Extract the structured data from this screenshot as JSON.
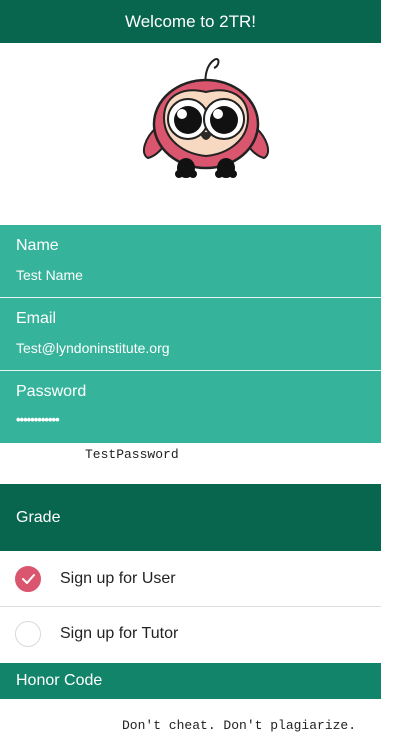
{
  "header": {
    "title": "Welcome to 2TR!"
  },
  "logo": {
    "icon": "owl-mascot-icon"
  },
  "form": {
    "name": {
      "label": "Name",
      "value": "Test Name"
    },
    "email": {
      "label": "Email",
      "value": "Test@lyndoninstitute.org"
    },
    "password": {
      "label": "Password",
      "masked_value": "••••••••••••",
      "debug_text": "TestPassword"
    }
  },
  "grade": {
    "label": "Grade"
  },
  "signup_options": [
    {
      "label": "Sign up for User",
      "checked": true
    },
    {
      "label": "Sign up for Tutor",
      "checked": false
    }
  ],
  "honor_code": {
    "label": "Honor Code",
    "text": "Don't cheat. Don't plagiarize."
  },
  "colors": {
    "header_bg": "#08664f",
    "field_bg": "#36b49b",
    "honor_bg": "#12846a",
    "check_accent": "#d9566e"
  }
}
